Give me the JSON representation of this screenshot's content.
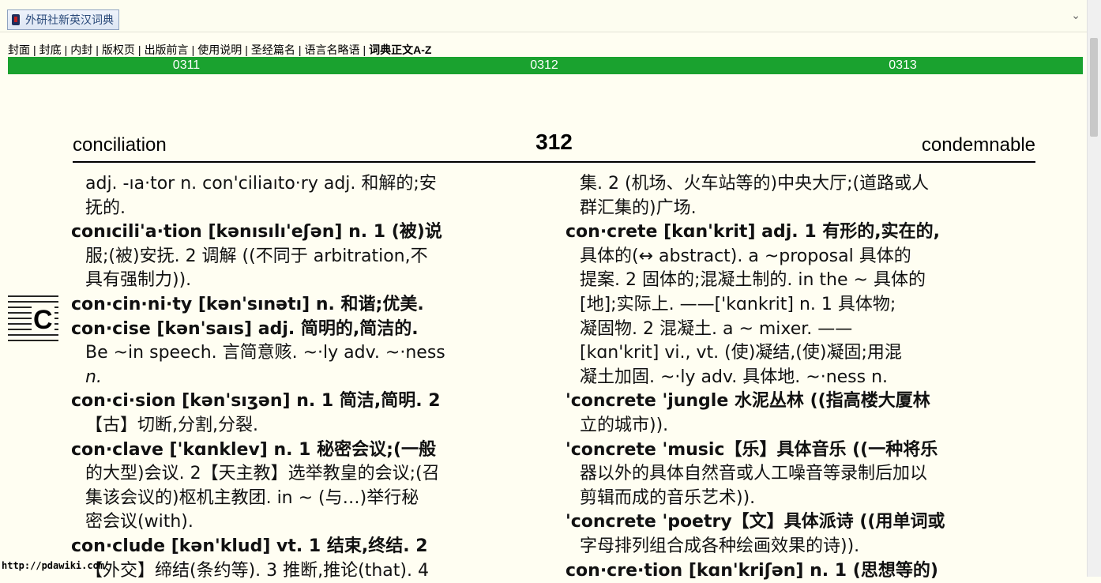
{
  "titlebar": {
    "title": "外研社新英汉词典",
    "book_icon": "book-icon",
    "chevron_icon": "chevron-down-icon"
  },
  "nav": {
    "items": [
      "封面",
      "封底",
      "内封",
      "版权页",
      "出版前言",
      "使用说明",
      "圣经篇名",
      "语言名略语",
      "词典正文A-Z"
    ],
    "separator": "|"
  },
  "pages": {
    "prev": "0311",
    "current": "0312",
    "next": "0313"
  },
  "dictionary": {
    "guide_left": "conciliation",
    "page_number": "312",
    "guide_right": "condemnable",
    "thumb_letter": "C",
    "left_lines": [
      "adj. -ıa·tor n. con'ciliaıto·ry adj. 和解的;安",
      "抚的.",
      "conıcili'a·tion [kənısılı'eʃən] n. 1 (被)说",
      "服;(被)安抚. 2 调解 ((不同于 arbitration,不",
      "具有强制力)).",
      "con·cin·ni·ty [kən'sınətı] n. 和谐;优美.",
      "con·cise [kən'saıs] adj. 简明的,简洁的.",
      "Be ~in speech. 言简意赅. ~·ly adv. ~·ness",
      "n.",
      "con·ci·sion [kən'sıʒən] n. 1 简洁,简明. 2",
      "【古】切断,分割,分裂.",
      "con·clave ['kɑnklev] n. 1 秘密会议;(一般",
      "的大型)会议. 2【天主教】选举教皇的会议;(召",
      "集该会议的)枢机主教团. in ~ (与…)举行秘",
      "密会议(with).",
      "con·clude [kən'klud] vt. 1 结束,终结. 2",
      "【外交】缔结(条约等). 3 推断,推论(that). 4"
    ],
    "right_lines": [
      "集. 2 (机场、火车站等的)中央大厅;(道路或人",
      "群汇集的)广场.",
      "con·crete [kɑn'krit] adj. 1 有形的,实在的,",
      "具体的(↔ abstract). a ~proposal 具体的",
      "提案. 2 固体的;混凝土制的. in the ~ 具体的",
      "[地];实际上. ——['kɑnkrit] n. 1 具体物;",
      "凝固物. 2 混凝土. a ~ mixer. ——",
      "[kɑn'krit] vi., vt. (使)凝结,(使)凝固;用混",
      "凝土加固. ~·ly adv. 具体地. ~·ness n.",
      "'concrete 'jungle 水泥丛林 ((指高楼大厦林",
      "立的城市)).",
      "'concrete 'music【乐】具体音乐 ((一种将乐",
      "器以外的具体自然音或人工噪音等录制后加以",
      "剪辑而成的音乐艺术)).",
      "'concrete 'poetry【文】具体派诗 ((用单词或",
      "字母排列组合成各种绘画效果的诗)).",
      "con·cre·tion [kɑn'kriʃən] n. 1 (思想等的)"
    ]
  },
  "watermark": "http://pdawiki.com"
}
